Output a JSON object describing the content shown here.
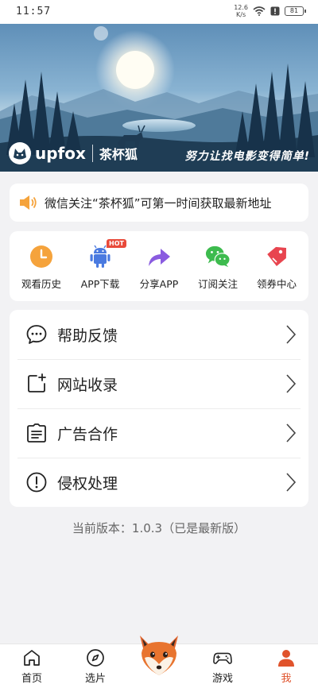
{
  "status": {
    "time": "11:57",
    "net_speed_value": "12.6",
    "net_speed_unit": "K/s",
    "battery": "81"
  },
  "banner": {
    "brand_latin": "upfox",
    "brand_cn": "茶杯狐",
    "slogan": "努力让找电影变得简单!"
  },
  "notice": {
    "icon": "speaker-icon",
    "text": "微信关注“茶杯狐”可第一时间获取最新地址"
  },
  "quick_actions": [
    {
      "label": "观看历史",
      "icon": "clock-icon",
      "color": "#f5a33c"
    },
    {
      "label": "APP下载",
      "icon": "android-icon",
      "color": "#4a7ae0",
      "badge": "HOT"
    },
    {
      "label": "分享APP",
      "icon": "share-icon",
      "color": "#8a5ce0"
    },
    {
      "label": "订阅关注",
      "icon": "wechat-icon",
      "color": "#3dbb4e"
    },
    {
      "label": "领券中心",
      "icon": "coupon-icon",
      "color": "#e8454f"
    }
  ],
  "menu": [
    {
      "label": "帮助反馈",
      "icon": "chat-bubble-icon"
    },
    {
      "label": "网站收录",
      "icon": "add-page-icon"
    },
    {
      "label": "广告合作",
      "icon": "document-icon"
    },
    {
      "label": "侵权处理",
      "icon": "alert-icon"
    }
  ],
  "version_text": "当前版本：1.0.3（已是最新版）",
  "tabs": [
    {
      "label": "首页",
      "icon": "home-icon"
    },
    {
      "label": "选片",
      "icon": "compass-icon"
    },
    {
      "label": "",
      "icon": "fox-mascot-icon"
    },
    {
      "label": "游戏",
      "icon": "gamepad-icon"
    },
    {
      "label": "我",
      "icon": "person-icon",
      "active": true
    }
  ],
  "colors": {
    "accent": "#e0532c",
    "hot": "#e84a3a",
    "background": "#f2f2f4"
  }
}
